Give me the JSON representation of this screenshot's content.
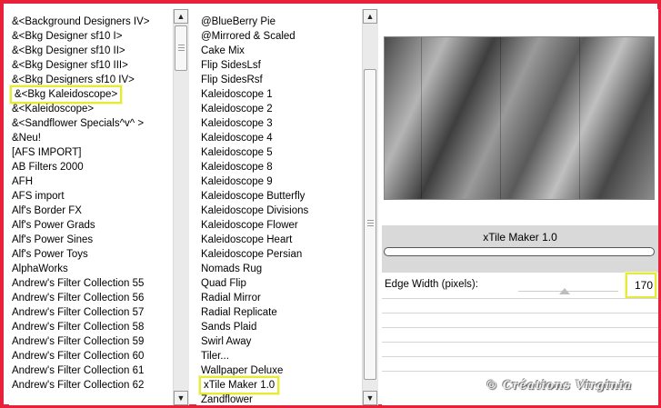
{
  "left_list": {
    "items": [
      "&<Background Designers IV>",
      "&<Bkg Designer sf10 I>",
      "&<Bkg Designer sf10 II>",
      "&<Bkg Designer sf10 III>",
      "&<Bkg Designers sf10 IV>",
      "&<Bkg Kaleidoscope>",
      "&<Kaleidoscope>",
      "&<Sandflower Specials^v^ >",
      "&Neu!",
      "[AFS IMPORT]",
      "AB Filters 2000",
      "AFH",
      "AFS import",
      "Alf's Border FX",
      "Alf's Power Grads",
      "Alf's Power Sines",
      "Alf's Power Toys",
      "AlphaWorks",
      "Andrew's Filter Collection 55",
      "Andrew's Filter Collection 56",
      "Andrew's Filter Collection 57",
      "Andrew's Filter Collection 58",
      "Andrew's Filter Collection 59",
      "Andrew's Filter Collection 60",
      "Andrew's Filter Collection 61",
      "Andrew's Filter Collection 62"
    ],
    "selected": "&<Bkg Kaleidoscope>"
  },
  "mid_list": {
    "items": [
      "@BlueBerry Pie",
      "@Mirrored & Scaled",
      "Cake Mix",
      "Flip SidesLsf",
      "Flip SidesRsf",
      "Kaleidoscope 1",
      "Kaleidoscope 2",
      "Kaleidoscope 3",
      "Kaleidoscope 4",
      "Kaleidoscope 5",
      "Kaleidoscope 8",
      "Kaleidoscope 9",
      "Kaleidoscope Butterfly",
      "Kaleidoscope Divisions",
      "Kaleidoscope Flower",
      "Kaleidoscope Heart",
      "Kaleidoscope Persian",
      "Nomads Rug",
      "Quad Flip",
      "Radial Mirror",
      "Radial Replicate",
      "Sands Plaid",
      "Swirl Away",
      "Tiler...",
      "Wallpaper Deluxe",
      "xTile Maker 1.0",
      "Zandflower"
    ],
    "selected": "xTile Maker 1.0"
  },
  "filter": {
    "title": "xTile Maker 1.0",
    "param_label": "Edge Width (pixels):",
    "param_value": "170"
  },
  "watermark": "© Créations Virginia"
}
